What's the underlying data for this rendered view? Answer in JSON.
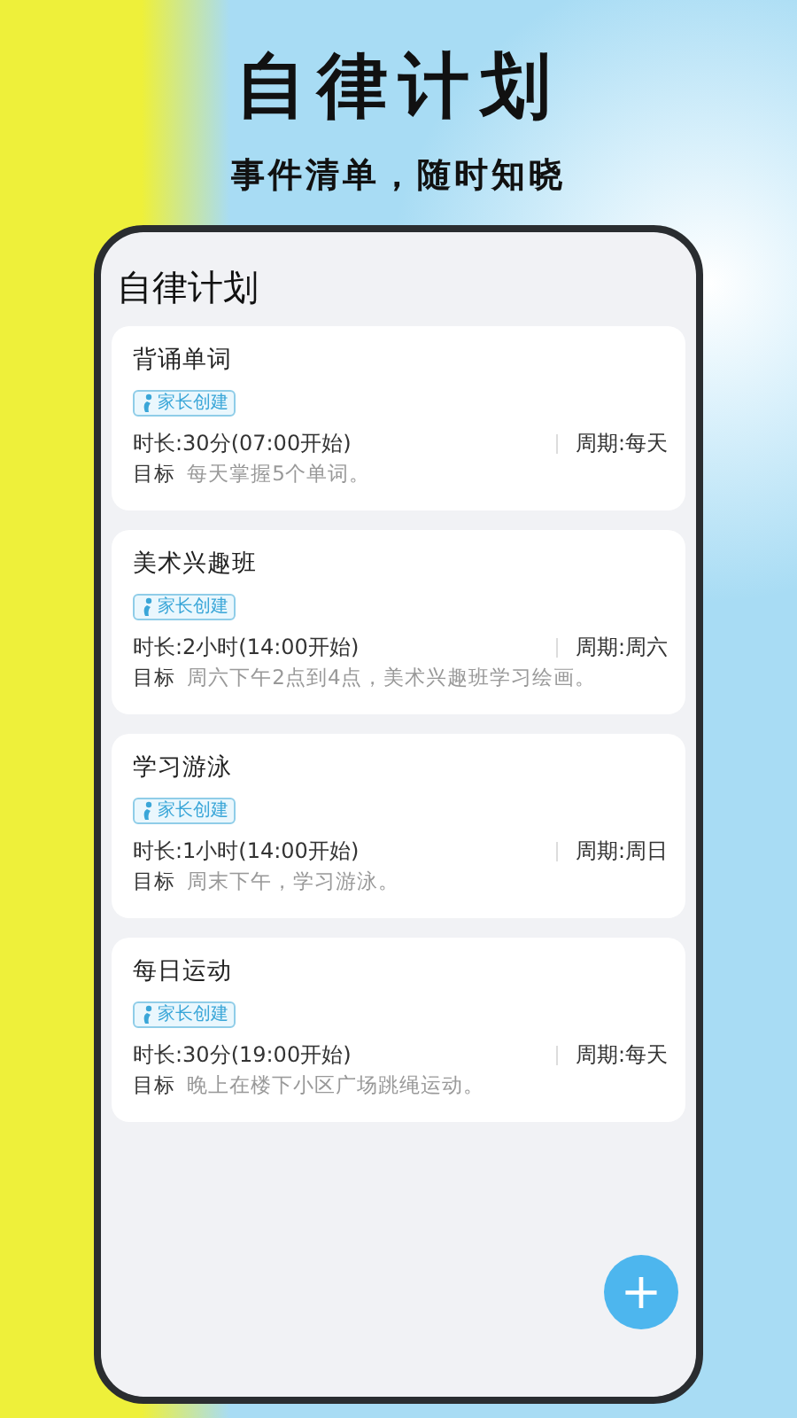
{
  "headline": "自律计划",
  "subheadline": "事件清单，随时知晓",
  "screen": {
    "title": "自律计划",
    "plans": [
      {
        "name": "背诵单词",
        "badge": "家长创建",
        "duration": "时长:30分(07:00开始)",
        "period": "周期:每天",
        "goal_label": "目标",
        "goal": "每天掌握5个单词。"
      },
      {
        "name": "美术兴趣班",
        "badge": "家长创建",
        "duration": "时长:2小时(14:00开始)",
        "period": "周期:周六",
        "goal_label": "目标",
        "goal": "周六下午2点到4点，美术兴趣班学习绘画。"
      },
      {
        "name": "学习游泳",
        "badge": "家长创建",
        "duration": "时长:1小时(14:00开始)",
        "period": "周期:周日",
        "goal_label": "目标",
        "goal": "周末下午，学习游泳。"
      },
      {
        "name": "每日运动",
        "badge": "家长创建",
        "duration": "时长:30分(19:00开始)",
        "period": "周期:每天",
        "goal_label": "目标",
        "goal": "晚上在楼下小区广场跳绳运动。"
      }
    ],
    "add_button": "+"
  }
}
